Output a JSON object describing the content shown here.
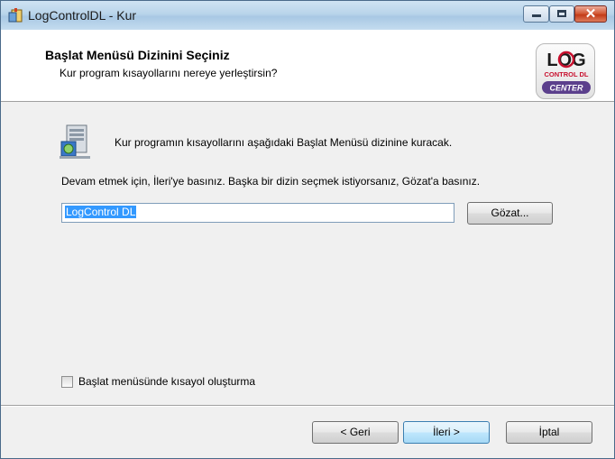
{
  "window": {
    "title": "LogControlDL - Kur",
    "controls": {
      "minimize": "minimize",
      "maximize": "maximize",
      "close": "✕"
    }
  },
  "header": {
    "title": "Başlat Menüsü Dizinini Seçiniz",
    "subtitle": "Kur program kısayollarını nereye yerleştirsin?",
    "logo": {
      "line1": "LOG",
      "line2": "CONTROL DL",
      "line3": "CENTER"
    }
  },
  "main": {
    "intro": "Kur programın kısayollarını aşağıdaki Başlat Menüsü dizinine kuracak.",
    "instruction": "Devam etmek için, İleri'ye basınız. Başka bir dizin seçmek istiyorsanız, Gözat'a basınız.",
    "folder_input": {
      "value": "LogControl DL"
    },
    "browse_label": "Gözat...",
    "checkbox": {
      "label": "Başlat menüsünde kısayol oluşturma",
      "checked": false
    }
  },
  "footer": {
    "back_label": "< Geri",
    "next_label": "İleri >",
    "cancel_label": "İptal"
  },
  "colors": {
    "accent": "#3399ff",
    "logo_red": "#c8102e",
    "logo_purple": "#5b3f8c"
  },
  "icons": [
    "app-installer-icon",
    "start-menu-folder-icon",
    "log-control-logo"
  ]
}
